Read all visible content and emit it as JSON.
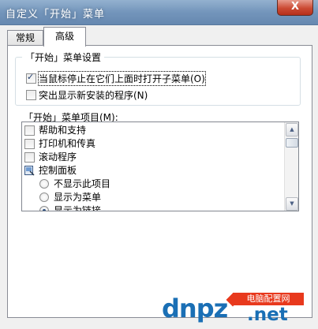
{
  "window": {
    "title": "自定义「开始」菜单",
    "close_glyph": "X"
  },
  "tabs": [
    {
      "label": "常规",
      "active": false
    },
    {
      "label": "高级",
      "active": true
    }
  ],
  "settings_group": {
    "legend": "「开始」菜单设置",
    "options": [
      {
        "label": "当鼠标停止在它们上面时打开子菜单(O)",
        "checked": true
      },
      {
        "label": "突出显示新安装的程序(N)",
        "checked": false
      }
    ]
  },
  "items_list": {
    "label": "「开始」菜单项目(M):",
    "rows": [
      {
        "type": "checkbox",
        "label": "帮助和支持",
        "checked": false
      },
      {
        "type": "checkbox",
        "label": "打印机和传真",
        "checked": false
      },
      {
        "type": "checkbox",
        "label": "滚动程序",
        "checked": false
      },
      {
        "type": "group",
        "label": "控制面板",
        "icon": "control-panel-icon"
      },
      {
        "type": "radio",
        "label": "不显示此项目",
        "selected": false
      },
      {
        "type": "radio",
        "label": "显示为菜单",
        "selected": false
      },
      {
        "type": "radio",
        "label": "显示为链接",
        "selected": true
      }
    ]
  },
  "watermark": {
    "brand": "dnpz",
    "tagline": "电脑配置网",
    "domain": ".net"
  },
  "colors": {
    "title_bar": "#7395bb",
    "close_button": "#cb4a33",
    "watermark_blue": "#1a6fb5",
    "watermark_red": "#e8391d"
  }
}
